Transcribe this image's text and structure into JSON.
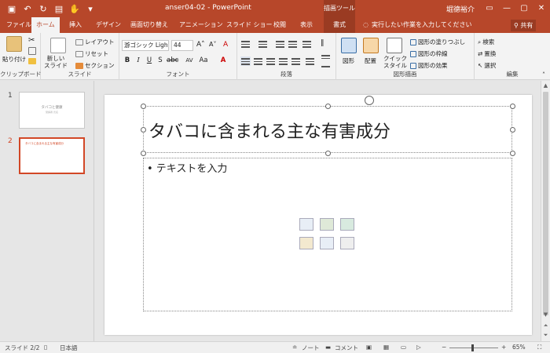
{
  "window": {
    "title": "anser04-02  -  PowerPoint",
    "context_tools": "描画ツール",
    "user": "堀德裕介",
    "accent": "#b7472a"
  },
  "tabs": [
    {
      "label": "ファイル"
    },
    {
      "label": "ホーム"
    },
    {
      "label": "挿入"
    },
    {
      "label": "デザイン"
    },
    {
      "label": "画面切り替え"
    },
    {
      "label": "アニメーション"
    },
    {
      "label": "スライド ショー"
    },
    {
      "label": "校閲"
    },
    {
      "label": "表示"
    },
    {
      "label": "書式"
    }
  ],
  "tell_me": "実行したい作業を入力してください",
  "share": "共有",
  "ribbon": {
    "clipboard": {
      "paste": "貼り付け",
      "label": "クリップボード"
    },
    "slides": {
      "new_slide": "新しい\nスライド",
      "layout": "レイアウト",
      "reset": "リセット",
      "section": "セクション",
      "label": "スライド"
    },
    "font": {
      "family": "游ゴシック Ligh",
      "size": "44",
      "label": "フォント"
    },
    "paragraph": {
      "label": "段落"
    },
    "drawing": {
      "shapes": "図形",
      "arrange": "配置",
      "quick_styles": "クイック\nスタイル",
      "fill": "図形の塗りつぶし",
      "outline": "図形の枠線",
      "effects": "図形の効果",
      "label": "図形描画"
    },
    "editing": {
      "find": "検索",
      "replace": "置換",
      "select": "選択",
      "label": "編集"
    }
  },
  "thumbnails": [
    {
      "num": "1",
      "title": "タバコと健康",
      "subtitle": "受講者 氏名"
    },
    {
      "num": "2",
      "title": "タバコに含まれる主な有害成分"
    }
  ],
  "slide": {
    "title": "タバコに含まれる主な有害成分",
    "bullet": "• テキストを入力"
  },
  "status": {
    "slide": "スライド 2/2",
    "lang": "日本語",
    "notes": "ノート",
    "comments": "コメント",
    "zoom": "65%"
  }
}
